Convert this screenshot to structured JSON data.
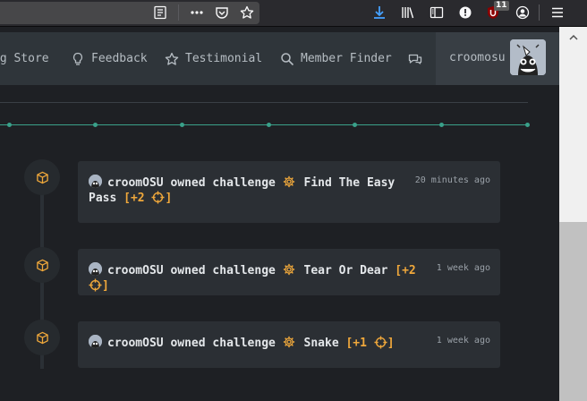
{
  "browser_toolbar": {
    "icons": [
      "reader-view-icon",
      "more-actions-icon",
      "pocket-icon",
      "bookmark-star-icon",
      "downloads-icon",
      "library-icon",
      "sidebar-icon",
      "privacy-icon",
      "ublock-icon",
      "account-icon",
      "hamburger-menu-icon"
    ],
    "ublock_badge": "11"
  },
  "site_nav": {
    "items": [
      {
        "label": "ag Store",
        "icon": "shopping-bag-icon"
      },
      {
        "label": "Feedback",
        "icon": "lightbulb-icon"
      },
      {
        "label": "Testimonial",
        "icon": "star-icon"
      },
      {
        "label": "Member Finder",
        "icon": "search-icon"
      },
      {
        "label": "",
        "icon": "chat-icon"
      }
    ],
    "username": "croomosu"
  },
  "activity": [
    {
      "user": "croomOSU",
      "verb": "owned challenge",
      "challenge": "Find The Easy Pass",
      "points_open": "[+2",
      "points_close": "]",
      "time": "20 minutes ago"
    },
    {
      "user": "croomOSU",
      "verb": "owned challenge",
      "challenge": "Tear Or Dear",
      "points_open": "[+2",
      "points_close": "]",
      "time": "1 week ago"
    },
    {
      "user": "croomOSU",
      "verb": "owned challenge",
      "challenge": "Snake",
      "points_open": "[+1",
      "points_close": "]",
      "time": "1 week ago"
    }
  ],
  "colors": {
    "accent_orange": "#f0a83b",
    "chart_green": "#3aa18a",
    "background": "#1e2024",
    "card": "#2b2f34"
  }
}
